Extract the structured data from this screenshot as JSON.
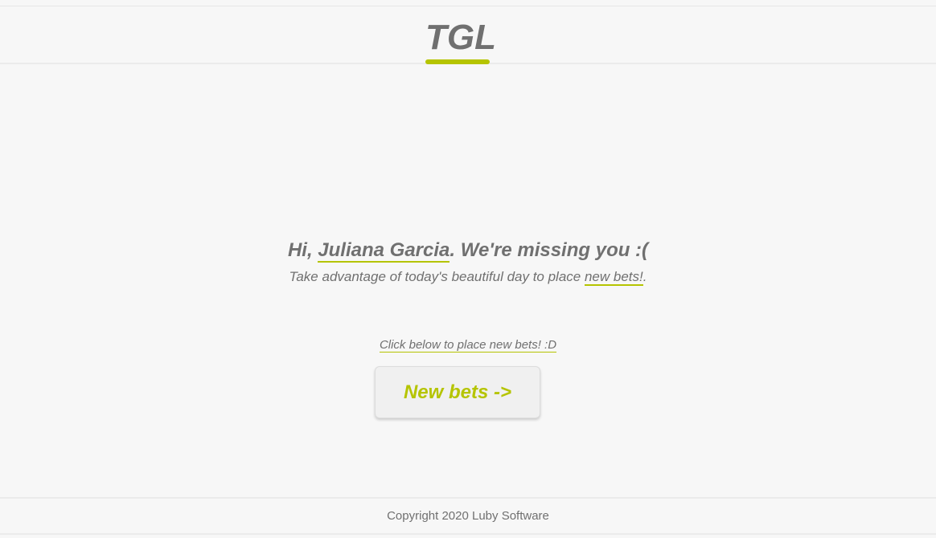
{
  "header": {
    "logo_text": "TGL"
  },
  "main": {
    "greeting_prefix": "Hi, ",
    "user_name": "Juliana Garcia",
    "greeting_suffix": ". We're missing you :(",
    "subtext_prefix": "Take advantage of today's beautiful day to place ",
    "subtext_link": "new bets!",
    "subtext_suffix": ".",
    "click_below_text": "Click below to place new bets! :D",
    "new_bets_button_label": "New bets ->"
  },
  "footer": {
    "copyright": "Copyright 2020 Luby Software"
  },
  "colors": {
    "accent": "#b5c401",
    "text": "#707070",
    "background": "#f7f7f7"
  }
}
